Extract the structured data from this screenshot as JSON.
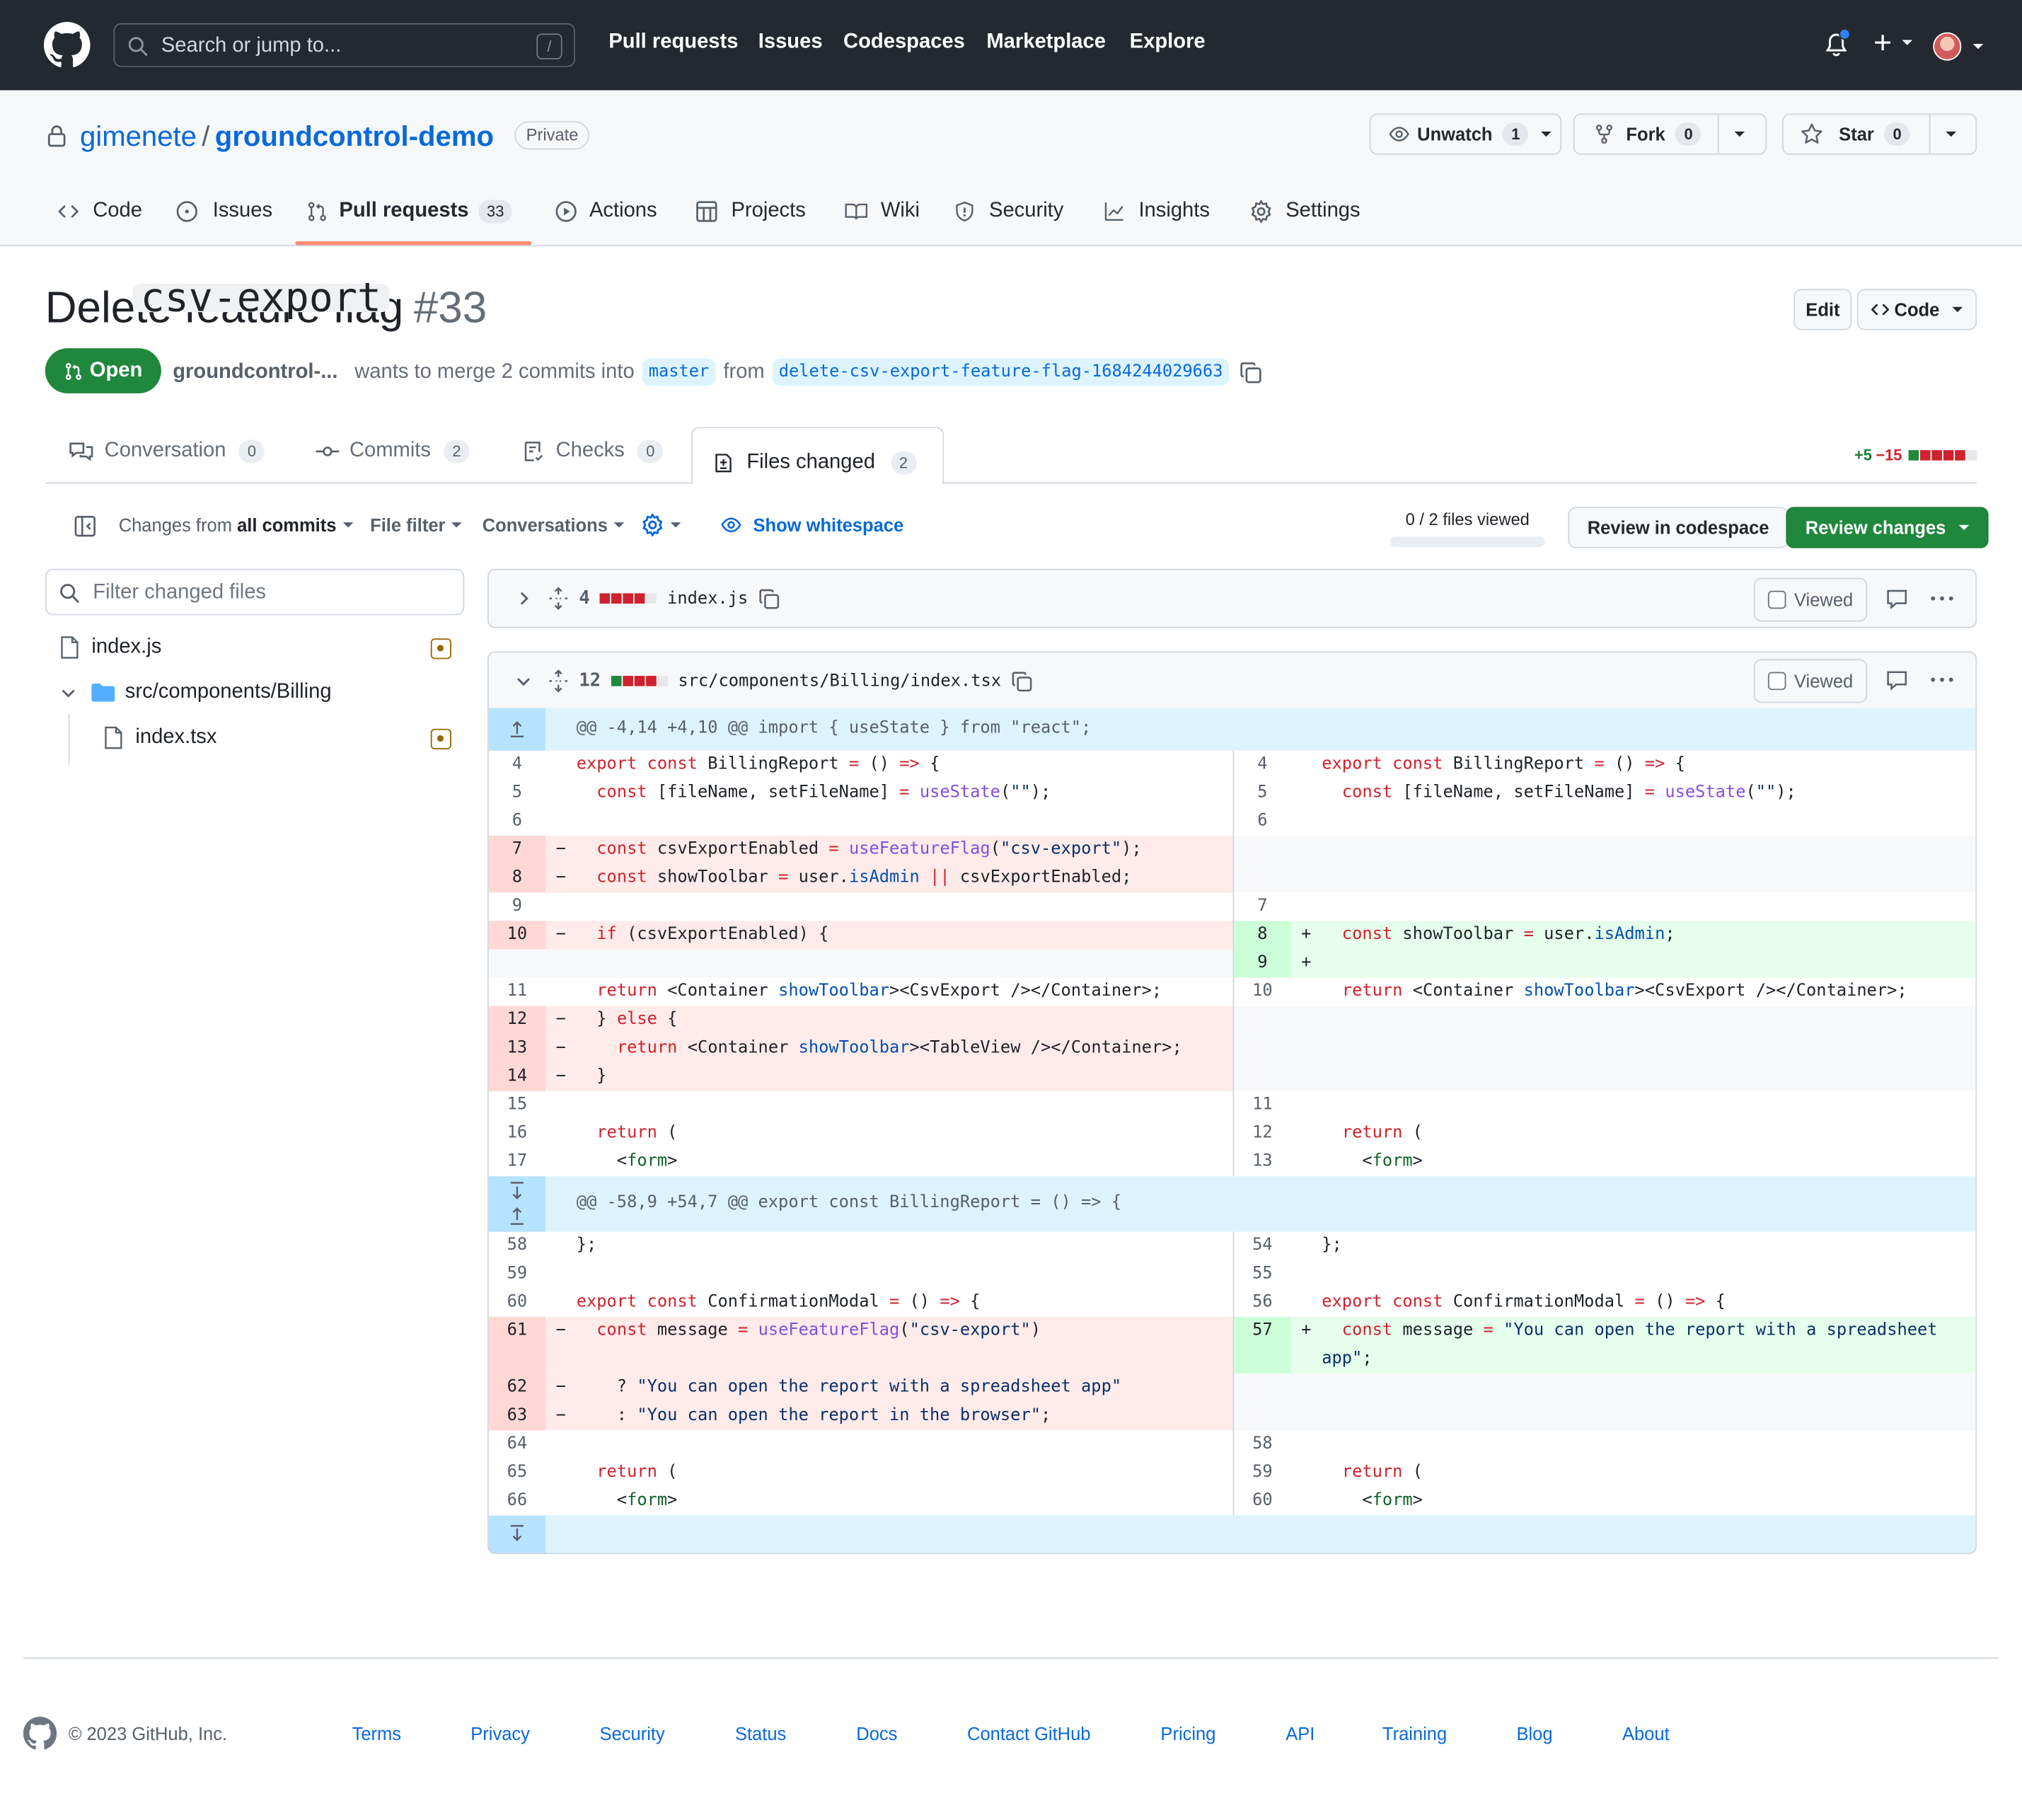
{
  "header": {
    "search_placeholder": "Search or jump to...",
    "search_shortcut": "/",
    "nav": [
      "Pull requests",
      "Issues",
      "Codespaces",
      "Marketplace",
      "Explore"
    ],
    "add_label": "+"
  },
  "repo": {
    "owner": "gimenete",
    "separator": "/",
    "name": "groundcontrol-demo",
    "visibility": "Private",
    "unwatch_label": "Unwatch",
    "unwatch_count": "1",
    "fork_label": "Fork",
    "fork_count": "0",
    "star_label": "Star",
    "star_count": "0",
    "tabs": [
      {
        "label": "Code"
      },
      {
        "label": "Issues"
      },
      {
        "label": "Pull requests",
        "count": "33"
      },
      {
        "label": "Actions"
      },
      {
        "label": "Projects"
      },
      {
        "label": "Wiki"
      },
      {
        "label": "Security"
      },
      {
        "label": "Insights"
      },
      {
        "label": "Settings"
      }
    ]
  },
  "pr": {
    "title_before": "Delete",
    "title_code": "csv-export",
    "title_after": "feature flag",
    "number": "#33",
    "edit_label": "Edit",
    "code_label": "Code",
    "state": "Open",
    "author": "groundcontrol-...",
    "merge_text": "wants to merge 2 commits into",
    "base_branch": "master",
    "from_text": "from",
    "head_branch": "delete-csv-export-feature-flag-1684244029663",
    "tabs": [
      {
        "label": "Conversation",
        "count": "0"
      },
      {
        "label": "Commits",
        "count": "2"
      },
      {
        "label": "Checks",
        "count": "0"
      },
      {
        "label": "Files changed",
        "count": "2"
      }
    ],
    "additions": "+5",
    "deletions": "−15"
  },
  "toolbar": {
    "changes_from": "Changes from",
    "all_commits": "all commits",
    "file_filter": "File filter",
    "conversations": "Conversations",
    "show_whitespace": "Show whitespace",
    "files_viewed": "0 / 2 files viewed",
    "review_codespace": "Review in codespace",
    "review_changes": "Review changes"
  },
  "file_tree": {
    "filter_placeholder": "Filter changed files",
    "items": [
      "index.js",
      "src/components/Billing",
      "index.tsx"
    ]
  },
  "files": [
    {
      "changes": "4",
      "path": "index.js",
      "viewed_label": "Viewed"
    },
    {
      "changes": "12",
      "path": "src/components/Billing/index.tsx",
      "viewed_label": "Viewed"
    }
  ],
  "diff": {
    "hunk1": "@@ -4,14 +4,10 @@ import { useState } from \"react\";",
    "hunk2": "@@ -58,9 +54,7 @@ export const BillingReport = () => {"
  },
  "footer": {
    "copyright": "© 2023 GitHub, Inc.",
    "links": [
      "Terms",
      "Privacy",
      "Security",
      "Status",
      "Docs",
      "Contact GitHub",
      "Pricing",
      "API",
      "Training",
      "Blog",
      "About"
    ]
  },
  "colors": {
    "header_bg": "#24292f",
    "accent_blue": "#0969da",
    "open_green": "#1f883d",
    "tab_underline": "#fd8c73",
    "deletion_bg": "#ffebe9",
    "addition_bg": "#e6ffec",
    "hunk_bg": "#ddf4ff"
  },
  "icons": [
    "github-logo-icon",
    "search-icon",
    "bell-icon",
    "plus-icon",
    "eye-icon",
    "fork-icon",
    "star-icon",
    "lock-icon",
    "code-icon",
    "issue-icon",
    "pull-request-icon",
    "play-icon",
    "table-icon",
    "book-icon",
    "shield-icon",
    "graph-icon",
    "gear-icon",
    "comment-icon",
    "commit-icon",
    "checklist-icon",
    "file-diff-icon",
    "sidebar-icon",
    "file-icon",
    "folder-icon",
    "copy-icon",
    "kebab-icon",
    "chevron-icon",
    "unfold-icon",
    "expand-icon"
  ]
}
